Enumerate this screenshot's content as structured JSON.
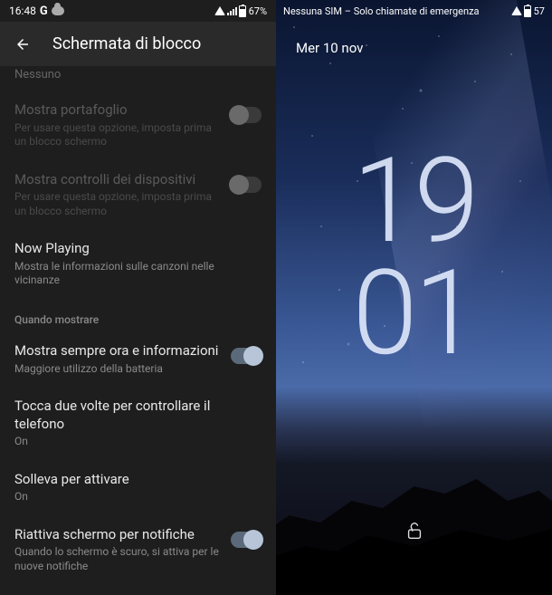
{
  "left": {
    "statusBar": {
      "time": "16:48",
      "gIcon": "G",
      "battery": "67%"
    },
    "appBar": {
      "title": "Schermata di blocco"
    },
    "cutOff": "Nessuno",
    "settings": {
      "wallet": {
        "title": "Mostra portafoglio",
        "sub": "Per usare questa opzione, imposta prima un blocco schermo"
      },
      "devices": {
        "title": "Mostra controlli dei dispositivi",
        "sub": "Per usare questa opzione, imposta prima un blocco schermo"
      },
      "nowPlaying": {
        "title": "Now Playing",
        "sub": "Mostra le informazioni sulle canzoni nelle vicinanze"
      },
      "sectionHead": "Quando mostrare",
      "always": {
        "title": "Mostra sempre ora e informazioni",
        "sub": "Maggiore utilizzo della batteria"
      },
      "doubleTap": {
        "title": "Tocca due volte per controllare il telefono",
        "sub": "On"
      },
      "lift": {
        "title": "Solleva per attivare",
        "sub": "On"
      },
      "wake": {
        "title": "Riattiva schermo per notifiche",
        "sub": "Quando lo schermo è scuro, si attiva per le nuove notifiche"
      }
    }
  },
  "right": {
    "statusBar": {
      "sim": "Nessuna SIM – Solo chiamate di emergenza",
      "battery": "57"
    },
    "date": "Mer 10 nov",
    "clock": {
      "hh": "19",
      "mm": "01"
    }
  }
}
